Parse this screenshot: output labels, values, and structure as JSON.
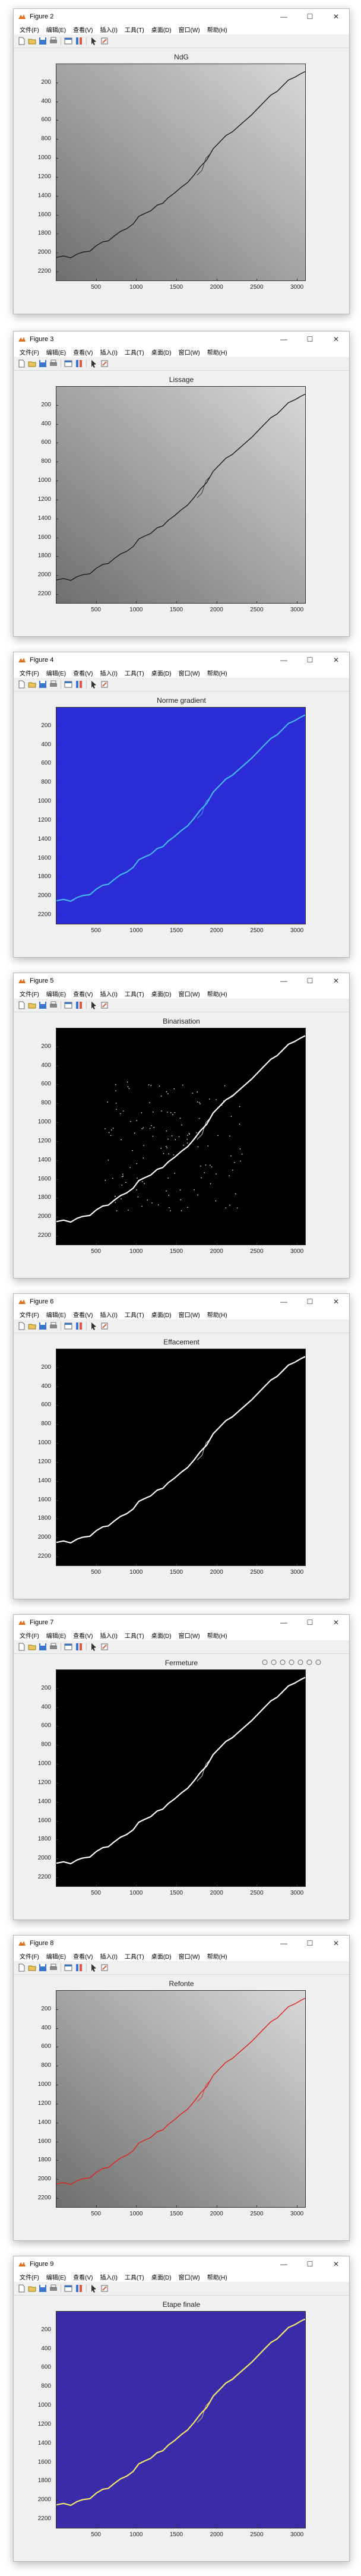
{
  "windows": [
    {
      "title": "Figure 2",
      "plot_title": "NdG",
      "background": "gray",
      "crack_color": "#1a1a1a",
      "axes_toolbar": false
    },
    {
      "title": "Figure 3",
      "plot_title": "Lissage",
      "background": "gray",
      "crack_color": "#1a1a1a",
      "axes_toolbar": false
    },
    {
      "title": "Figure 4",
      "plot_title": "Norme gradient",
      "background": "blue",
      "crack_color": "#45b7f2",
      "axes_toolbar": false
    },
    {
      "title": "Figure 5",
      "plot_title": "Binarisation",
      "background": "black",
      "crack_color": "#ffffff",
      "axes_toolbar": false
    },
    {
      "title": "Figure 6",
      "plot_title": "Effacement",
      "background": "black",
      "crack_color": "#ffffff",
      "axes_toolbar": false
    },
    {
      "title": "Figure 7",
      "plot_title": "Fermeture",
      "background": "black",
      "crack_color": "#ffffff",
      "axes_toolbar": true
    },
    {
      "title": "Figure 8",
      "plot_title": "Refonte",
      "background": "gray",
      "crack_color": "#e0201a",
      "axes_toolbar": false
    },
    {
      "title": "Figure 9",
      "plot_title": "Etape finale",
      "background": "indigo",
      "crack_color": "#f5e76a",
      "axes_toolbar": false
    }
  ],
  "menu": [
    "文件(F)",
    "编辑(E)",
    "查看(V)",
    "插入(I)",
    "工具(T)",
    "桌面(D)",
    "窗口(W)",
    "帮助(H)"
  ],
  "window_controls": {
    "minimize": "—",
    "maximize": "☐",
    "close": "✕"
  },
  "y_ticks": [
    "200",
    "400",
    "600",
    "800",
    "1000",
    "1200",
    "1400",
    "1600",
    "1800",
    "2000",
    "2200"
  ],
  "x_ticks": [
    "500",
    "1000",
    "1500",
    "2000",
    "2500",
    "3000"
  ],
  "image_extent": {
    "x": [
      1,
      3110
    ],
    "y": [
      1,
      2300
    ]
  },
  "crack_path": [
    [
      1,
      2055
    ],
    [
      90,
      2040
    ],
    [
      180,
      2060
    ],
    [
      260,
      2020
    ],
    [
      330,
      2000
    ],
    [
      420,
      1990
    ],
    [
      500,
      1930
    ],
    [
      580,
      1890
    ],
    [
      650,
      1880
    ],
    [
      720,
      1830
    ],
    [
      800,
      1780
    ],
    [
      880,
      1750
    ],
    [
      960,
      1700
    ],
    [
      1030,
      1620
    ],
    [
      1100,
      1590
    ],
    [
      1180,
      1560
    ],
    [
      1260,
      1500
    ],
    [
      1330,
      1480
    ],
    [
      1400,
      1420
    ],
    [
      1480,
      1370
    ],
    [
      1560,
      1310
    ],
    [
      1640,
      1260
    ],
    [
      1720,
      1180
    ],
    [
      1800,
      1090
    ],
    [
      1880,
      1020
    ],
    [
      1960,
      900
    ],
    [
      2040,
      830
    ],
    [
      2120,
      760
    ],
    [
      2200,
      720
    ],
    [
      2280,
      660
    ],
    [
      2360,
      600
    ],
    [
      2440,
      540
    ],
    [
      2520,
      470
    ],
    [
      2600,
      400
    ],
    [
      2680,
      330
    ],
    [
      2760,
      290
    ],
    [
      2830,
      230
    ],
    [
      2900,
      170
    ],
    [
      2980,
      140
    ],
    [
      3060,
      100
    ],
    [
      3110,
      80
    ]
  ],
  "colors": {
    "gray_light": "#d9d9d9",
    "gray_dark": "#6e6e6e",
    "blue_bg": "#2b2cd6",
    "black_bg": "#000000",
    "indigo_bg": "#3a2ca8",
    "toolbar_blue": "#3c76c8"
  }
}
